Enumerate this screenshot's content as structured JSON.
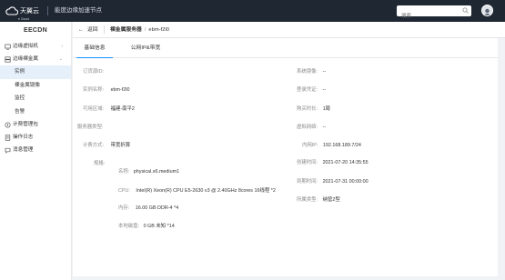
{
  "topbar": {
    "logo_text": "天翼云",
    "logo_sub": "e Cloud",
    "title": "能度边缘加速节点",
    "search_placeholder": "搜索",
    "colors": {
      "bar": "#1f2733",
      "accent": "#1890ff"
    }
  },
  "sidebar": {
    "brand": "EECDN",
    "items": [
      {
        "label": "边缘虚拟机",
        "icon": "cloud-server-icon",
        "expandable": true
      },
      {
        "label": "边缘裸金属",
        "icon": "bare-metal-icon",
        "expandable": true
      }
    ],
    "sub_items": [
      "实例",
      "裸金属镜像",
      "监控",
      "告警"
    ],
    "active_sub": "实例",
    "bottom_items": [
      {
        "label": "计费管理包",
        "icon": "billing-icon"
      },
      {
        "label": "操作日志",
        "icon": "log-icon"
      },
      {
        "label": "消息管理",
        "icon": "message-icon"
      }
    ]
  },
  "header": {
    "back_label": "返回",
    "breadcrumb_parent": "裸金属服务器",
    "breadcrumb_sep": "/",
    "breadcrumb_current": "ebm-f2l0"
  },
  "tabs": [
    {
      "label": "基础信息",
      "active": true
    },
    {
      "label": "公网IP&带宽",
      "active": false
    }
  ],
  "details": {
    "left": [
      {
        "label": "订货源ID:",
        "value": ""
      },
      {
        "label": "实例名称:",
        "value": "ebm-f2l0"
      },
      {
        "label": "可用区域:",
        "value": "福建-南平2"
      },
      {
        "label": "服务器类型:",
        "value": ""
      },
      {
        "label": "计费方式:",
        "value": "带宽折算"
      },
      {
        "label": "规格:",
        "value": ""
      }
    ],
    "right": [
      {
        "label": "系统镜像:",
        "value": "--"
      },
      {
        "label": "登录凭证:",
        "value": "--"
      },
      {
        "label": "购买时长:",
        "value": "1周"
      },
      {
        "label": "虚拟网络:",
        "value": "--"
      },
      {
        "label": "内网IP:",
        "value": "192.168.189.7/24"
      },
      {
        "label": "创建时间:",
        "value": "2021-07-20 14:35:55"
      },
      {
        "label": "到期时间:",
        "value": "2021-07-31 00:00:00"
      },
      {
        "label": "所属类型:",
        "value": "纳管2型"
      }
    ],
    "spec": [
      {
        "label": "名称:",
        "value": "physical.s6.medium1"
      },
      {
        "label": "CPU:",
        "value": "Intel(R) Xeon(R) CPU E5-2630 v3 @ 2.40GHz 8cores 16线程 *2"
      },
      {
        "label": "内存:",
        "value": "16.00 GB DDR-4 *4"
      },
      {
        "label": "本地磁盘:",
        "value": "0 GB 未知 *14"
      }
    ]
  }
}
